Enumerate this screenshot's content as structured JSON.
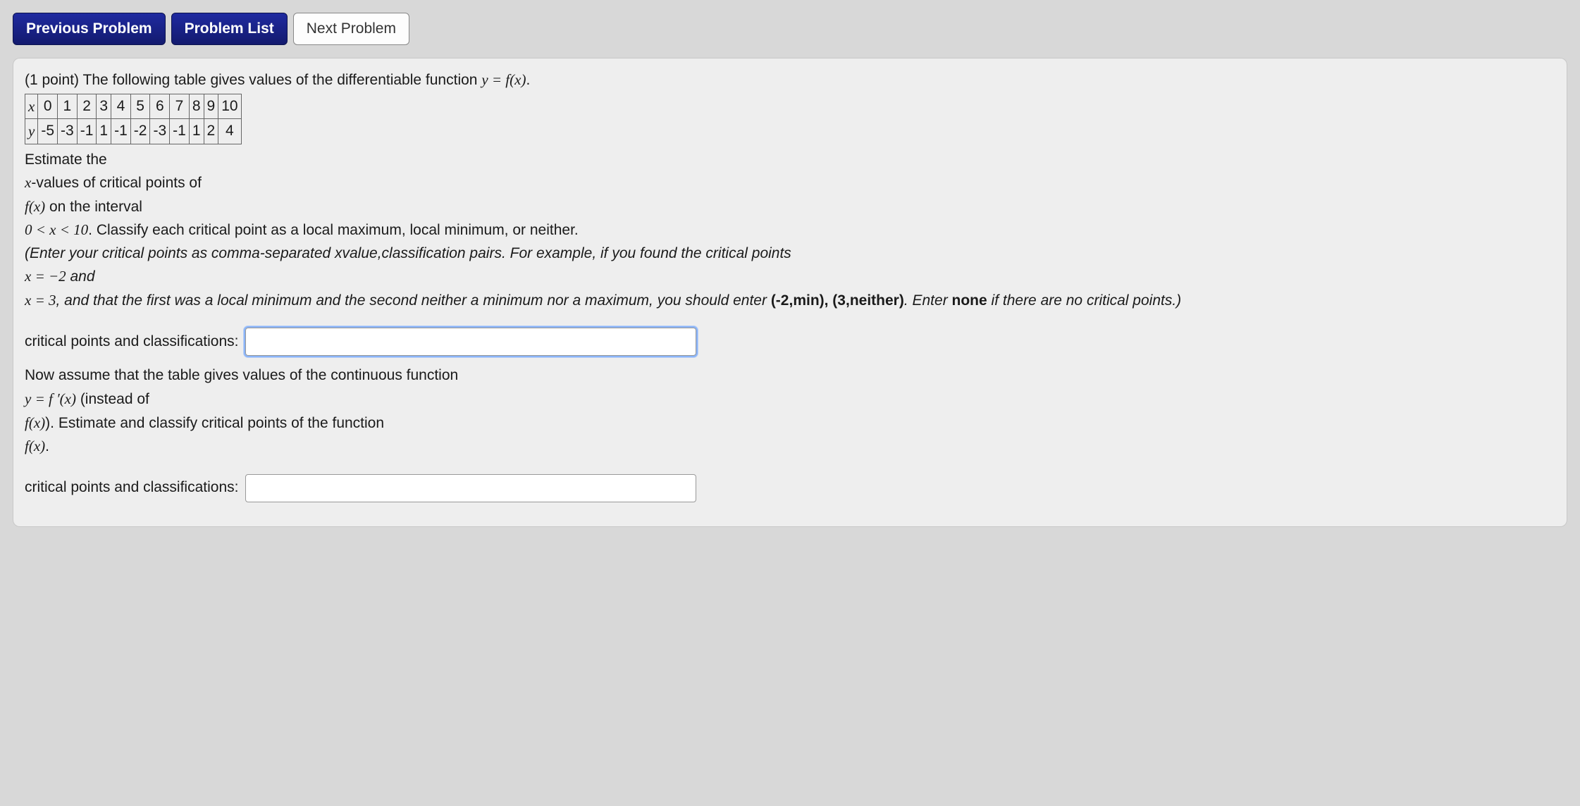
{
  "nav": {
    "prev": "Previous Problem",
    "list": "Problem List",
    "next": "Next Problem"
  },
  "problem": {
    "points_prefix": "(1 point) ",
    "intro_a": "The following table gives values of the differentiable function ",
    "intro_eq": "y = f(x)",
    "intro_b": ".",
    "table": {
      "row_x_label": "x",
      "row_x": [
        "0",
        "1",
        "2",
        "3",
        "4",
        "5",
        "6",
        "7",
        "8",
        "9",
        "10"
      ],
      "row_y_label": "y",
      "row_y": [
        "-5",
        "-3",
        "-1",
        "1",
        "-1",
        "-2",
        "-3",
        "-1",
        "1",
        "2",
        "4"
      ]
    },
    "estimate_line": "Estimate the",
    "line2a": "x",
    "line2b": "-values of critical points of",
    "line3a": "f(x)",
    "line3b": " on the interval",
    "line4a": "0 < x < 10",
    "line4b": ". Classify each critical point as a local maximum, local minimum, or neither.",
    "hint_a": "(Enter your critical points as comma-separated xvalue,classification pairs. For example, if you found the critical points",
    "hint_b_eq": "x = −2",
    "hint_b_tail": " and",
    "hint_c_eq": "x = 3",
    "hint_c_tail": ", and that the first was a local minimum and the second neither a minimum nor a maximum, you should enter ",
    "hint_example": "(-2,min), (3,neither)",
    "hint_d": ". Enter ",
    "hint_none": "none",
    "hint_e": " if there are no critical points.)",
    "field1_label": "critical points and classifications:",
    "part2_a": "Now assume that the table gives values of the continuous function",
    "part2_eq1": "y = f ′(x)",
    "part2_b": " (instead of",
    "part2_eq2": "f(x)",
    "part2_c": "). Estimate and classify critical points of the function",
    "part2_eq3": "f(x)",
    "part2_d": ".",
    "field2_label": "critical points and classifications:"
  }
}
